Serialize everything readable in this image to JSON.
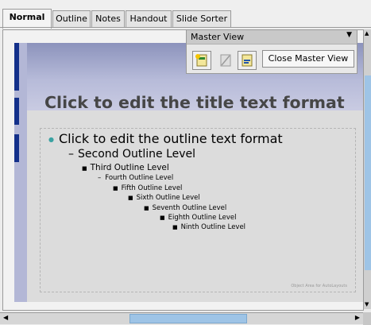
{
  "tabs": [
    "Normal",
    "Outline",
    "Notes",
    "Handout",
    "Slide Sorter"
  ],
  "slide": {
    "title": "Click to edit the title text format",
    "outline": [
      "Click to edit the outline text format",
      "Second Outline Level",
      "Third Outline Level",
      "Fourth Outline Level",
      "Fifth Outline Level",
      "Sixth Outline Level",
      "Seventh Outline Level",
      "Eighth Outline Level",
      "Ninth Outline Level"
    ],
    "autolayout_label": "Object Area for AutoLayouts"
  },
  "master_view": {
    "title": "Master View",
    "dropdown_glyph": "▼",
    "close_label": "Close Master View"
  },
  "scroll_glyphs": {
    "up": "▲",
    "down": "▼",
    "left": "◀",
    "right": "▶"
  },
  "colors": {
    "accent": "#13308a",
    "bullet": "#3aa2a2",
    "scroll_thumb": "#9ec4e6"
  }
}
